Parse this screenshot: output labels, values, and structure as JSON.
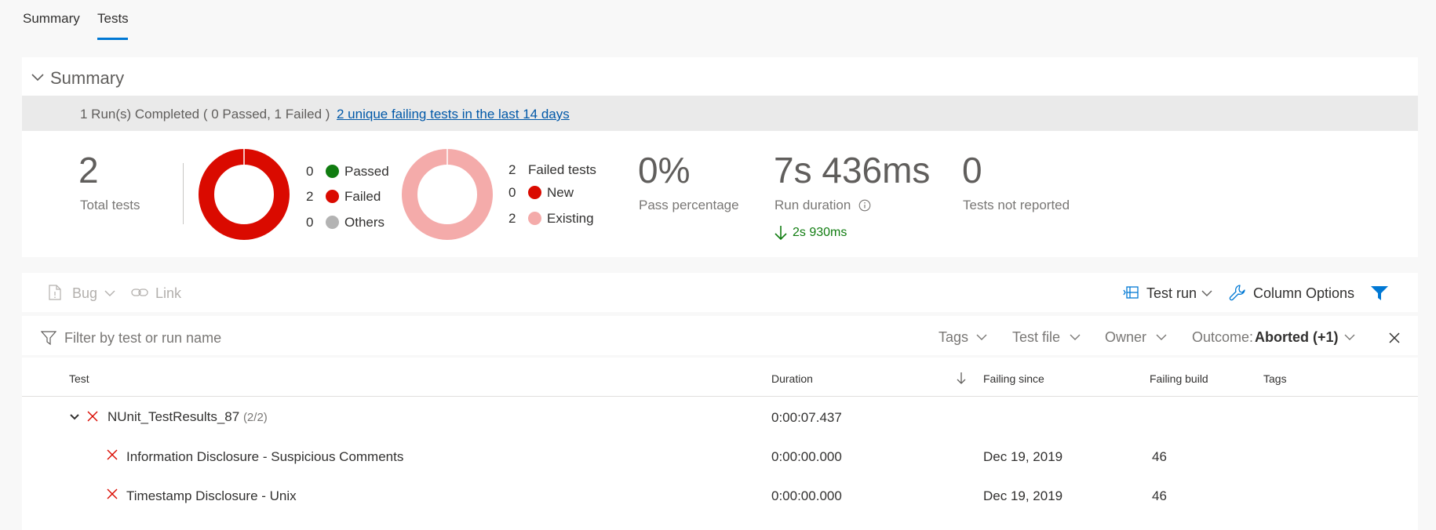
{
  "tabs": [
    {
      "label": "Summary"
    },
    {
      "label": "Tests"
    }
  ],
  "summary": {
    "title": "Summary",
    "banner_text": "1 Run(s) Completed ( 0 Passed, 1 Failed )",
    "banner_link": "2 unique failing tests in the last 14 days",
    "total_tests": {
      "value": "2",
      "label": "Total tests"
    },
    "outcome_chart": {
      "type": "donut",
      "slices": [
        {
          "label": "Passed",
          "value": 0,
          "color": "#107c10"
        },
        {
          "label": "Failed",
          "value": 2,
          "color": "#da0a00"
        },
        {
          "label": "Others",
          "value": 0,
          "color": "#b3b3b3"
        }
      ]
    },
    "outcome_legend": [
      {
        "count": "0",
        "label": "Passed",
        "color": "#107c10"
      },
      {
        "count": "2",
        "label": "Failed",
        "color": "#da0a00"
      },
      {
        "count": "0",
        "label": "Others",
        "color": "#b3b3b3"
      }
    ],
    "failed_chart": {
      "type": "donut",
      "slices": [
        {
          "label": "New",
          "value": 0,
          "color": "#da0a00"
        },
        {
          "label": "Existing",
          "value": 2,
          "color": "#f4abaa"
        }
      ]
    },
    "failed_legend": {
      "header_count": "2",
      "header_label": "Failed tests",
      "items": [
        {
          "count": "0",
          "label": "New",
          "color": "#da0a00"
        },
        {
          "count": "2",
          "label": "Existing",
          "color": "#f4abaa"
        }
      ]
    },
    "pass_percentage": {
      "value": "0%",
      "label": "Pass percentage"
    },
    "run_duration": {
      "value": "7s 436ms",
      "label": "Run duration",
      "delta": "2s 930ms",
      "delta_color": "#107c10"
    },
    "not_reported": {
      "value": "0",
      "label": "Tests not reported"
    }
  },
  "toolbar": {
    "bug_label": "Bug",
    "link_label": "Link",
    "test_run_label": "Test run",
    "column_options_label": "Column Options"
  },
  "filter": {
    "placeholder": "Filter by test or run name",
    "tags_label": "Tags",
    "test_file_label": "Test file",
    "owner_label": "Owner",
    "outcome_label": "Outcome:",
    "outcome_value": "Aborted (+1)"
  },
  "table": {
    "headers": [
      "Test",
      "Duration",
      "Failing since",
      "Failing build",
      "Tags"
    ],
    "group": {
      "name": "NUnit_TestResults_87",
      "count": "(2/2)",
      "duration": "0:00:07.437"
    },
    "rows": [
      {
        "test": "Information Disclosure - Suspicious Comments",
        "duration": "0:00:00.000",
        "failing_since": "Dec 19, 2019",
        "failing_build": "46",
        "tags": ""
      },
      {
        "test": "Timestamp Disclosure - Unix",
        "duration": "0:00:00.000",
        "failing_since": "Dec 19, 2019",
        "failing_build": "46",
        "tags": ""
      }
    ]
  },
  "colors": {
    "accent": "#0078d4",
    "failed": "#da0a00",
    "passed": "#107c10",
    "existing": "#f4abaa"
  }
}
